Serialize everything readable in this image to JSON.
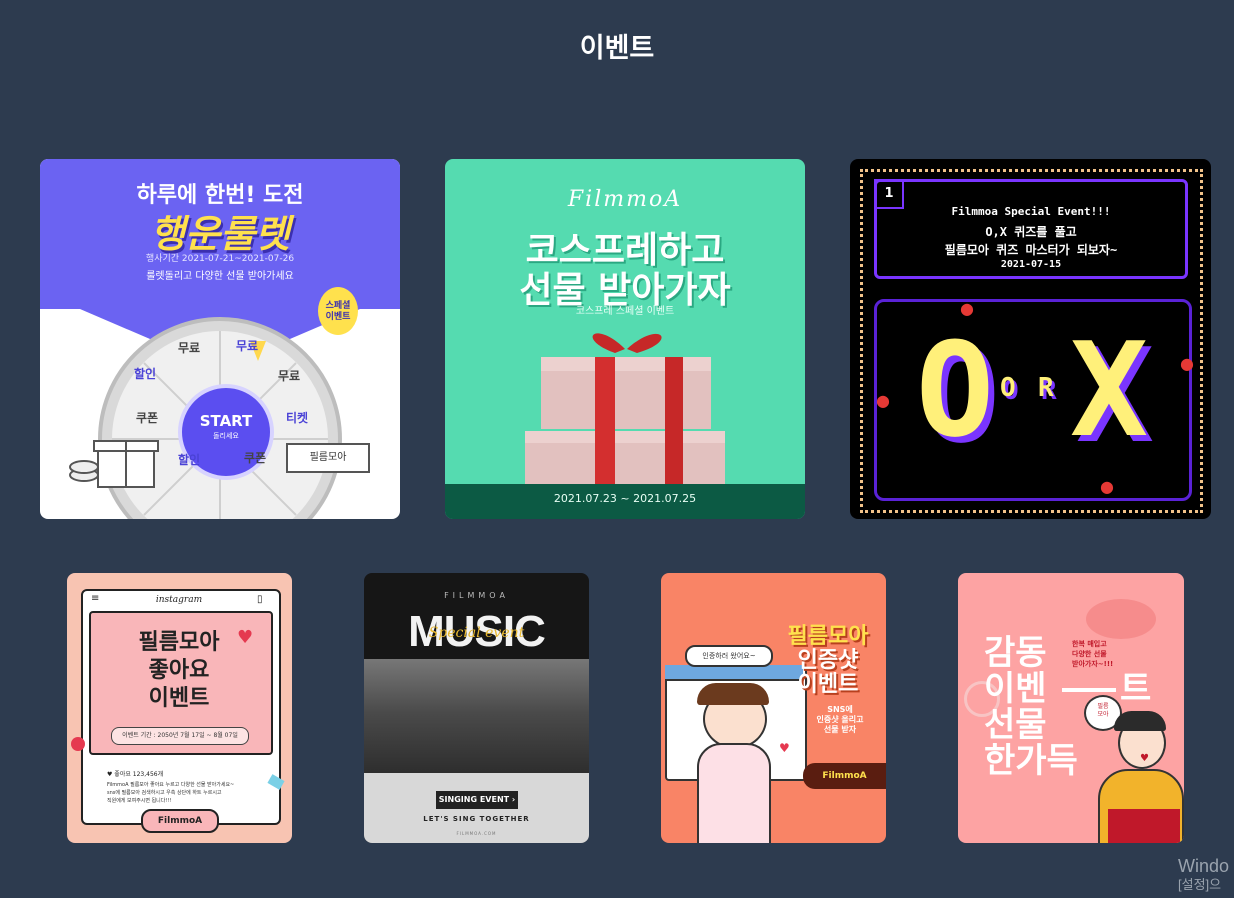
{
  "page": {
    "title": "이벤트"
  },
  "cards": [
    {
      "headline_top": "하루에 한번! 도전",
      "headline_main": "행운룰렛",
      "period": "행사기간  2021-07-21~2021-07-26",
      "subtext": "룰렛돌리고 다양한 선물 받아가세요",
      "badge_line1": "스페셜",
      "badge_line2": "이벤트",
      "start_label": "START",
      "start_sub": "돌리세요",
      "wheel_labels": [
        "무료",
        "무료",
        "무료",
        "티켓",
        "쿠폰",
        "할인",
        "쿠폰",
        "할인"
      ],
      "ticket_label": "필름모아"
    },
    {
      "brand": "FilmmoA",
      "title_line1": "코스프레하고",
      "title_line2": "선물 받아가자",
      "subtitle": "코스프레 스페셜 이벤트",
      "date_range": "2021.07.23 ~ 2021.07.25"
    },
    {
      "number": "1",
      "line1": "Filmmoa Special Event!!!",
      "line2": "O,X 퀴즈를 풀고",
      "line3": "필름모아 퀴즈 마스터가 되보자~",
      "date": "2021-07-15",
      "big_left": "O",
      "or_o": "O",
      "or_r": "R",
      "big_right": "X"
    },
    {
      "app_name": "instagram",
      "title_line1": "필름모아",
      "title_line2": "좋아요",
      "title_line3": "이벤트",
      "period": "이벤트 기간 : 2050년 7월 17일 ~ 8월 07일",
      "likes": "좋아요 123,456개",
      "desc_line1": "FilmmoA 필름모아 좋아요 누르고 다양한 선물 받아가세요~",
      "desc_line2": "sns에 필름모아 검색하시고 우측 상단에 하트 누르시고",
      "desc_line3": "직원에게 보여주시면 됩니다!!!",
      "button": "FilmmoA"
    },
    {
      "brand": "FILMMOA",
      "title": "MUSIC",
      "script": "Special event",
      "button": "SINGING EVENT",
      "tagline": "LET'S SING TOGETHER",
      "url": "FILMMOA.COM"
    },
    {
      "bubble": "인증하러 왔어요~",
      "title_line1": "필름모아",
      "title_line2": "인증샷",
      "title_line3": "이벤트",
      "sub_line1": "SNS에",
      "sub_line2": "인증샷 올리고",
      "sub_line3": "선물 받자",
      "tag": "FilmmoA"
    },
    {
      "line1": "감동",
      "line2": "이벤",
      "line2_end": "트",
      "line3": "선물",
      "line4": "한가득",
      "side_line1": "한복 매입고",
      "side_line2": "다양한 선물",
      "side_line3": "받아가자~!!!",
      "bubble_line1": "필름",
      "bubble_line2": "모아"
    }
  ],
  "watermark": {
    "line1": "Windo",
    "line2": "[설정]으"
  }
}
